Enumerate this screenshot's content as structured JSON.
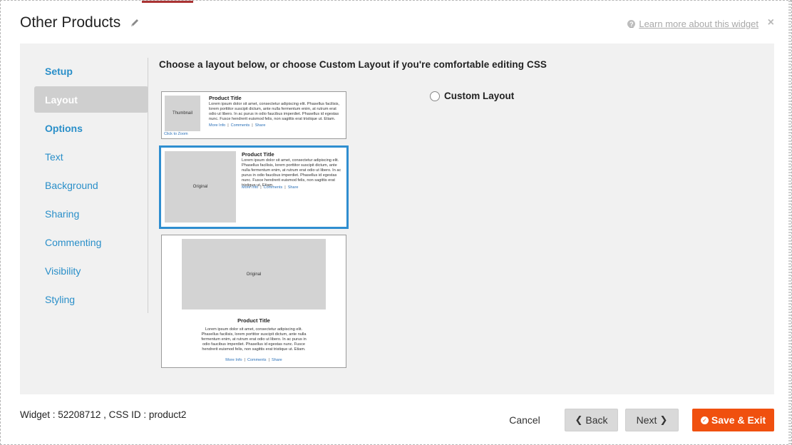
{
  "header": {
    "title": "Other Products",
    "learn_more": "Learn more about this widget",
    "close_glyph": "×",
    "help_glyph": "?"
  },
  "sidebar": {
    "items": [
      {
        "label": "Setup"
      },
      {
        "label": "Layout"
      },
      {
        "label": "Options"
      },
      {
        "label": "Text"
      },
      {
        "label": "Background"
      },
      {
        "label": "Sharing"
      },
      {
        "label": "Commenting"
      },
      {
        "label": "Visibility"
      },
      {
        "label": "Styling"
      }
    ],
    "active_index": 1
  },
  "main": {
    "instruction": "Choose a layout below, or choose Custom Layout if you're comfortable editing CSS",
    "custom_layout_label": "Custom Layout",
    "layouts": [
      {
        "image_label": "Thumbnail",
        "title": "Product Title",
        "body": "Lorem ipsum dolor sit amet, consectetur adipiscing elit. Phasellus facilisis, lorem porttitor suscipit dictum, ante nulla fermentum enim, at rutrum erat odio ut libero. In ac purus in odio faucibus imperdiet. Phasellus id egestas nunc. Fusce hendrerit euismod felis, non sagittis erat tristique ut. Etiam.",
        "link_more": "More Info",
        "link_comments": "Comments",
        "link_share": "Share",
        "zoom": "Click to Zoom"
      },
      {
        "image_label": "Original",
        "title": "Product Title",
        "body": "Lorem ipsum dolor sit amet, consectetur adipiscing elit. Phasellus facilisis, lorem porttitor suscipit dictum, ante nulla fermentum enim, at rutrum erat odio ut libero. In ac purus in odio faucibus imperdiet. Phasellus id egestas nunc. Fusce hendrerit euismod felis, non sagittis erat tristique ut. Etiam.",
        "link_more": "More Info",
        "link_comments": "Comments",
        "link_share": "Share"
      },
      {
        "image_label": "Original",
        "title": "Product Title",
        "body": "Lorem ipsum dolor sit amet, consectetur adipiscing elit. Phasellus facilisis, lorem porttitor suscipit dictum, ante nulla fermentum enim, at rutrum erat odio ut libero. In ac purus in odio faucibus imperdiet. Phasellus id egestas nunc. Fusce hendrerit euismod felis, non sagittis erat tristique ut. Etiam.",
        "link_more": "More Info",
        "link_comments": "Comments",
        "link_share": "Share"
      }
    ]
  },
  "footer": {
    "widget_info": "Widget : 52208712 , CSS ID : product2",
    "cancel": "Cancel",
    "back": "Back",
    "next": "Next",
    "save_exit": "Save & Exit",
    "back_glyph": "❮",
    "next_glyph": "❯",
    "check_glyph": "✓"
  },
  "colors": {
    "accent": "#2a8fc9",
    "selected_border": "#2f8ed0",
    "save_button": "#f0500f",
    "panel_bg": "#f1f1f1"
  },
  "icons": [
    "pencil-icon",
    "help-icon",
    "close-icon",
    "chevron-left-icon",
    "chevron-right-icon",
    "check-circle-icon",
    "radio-icon"
  ]
}
